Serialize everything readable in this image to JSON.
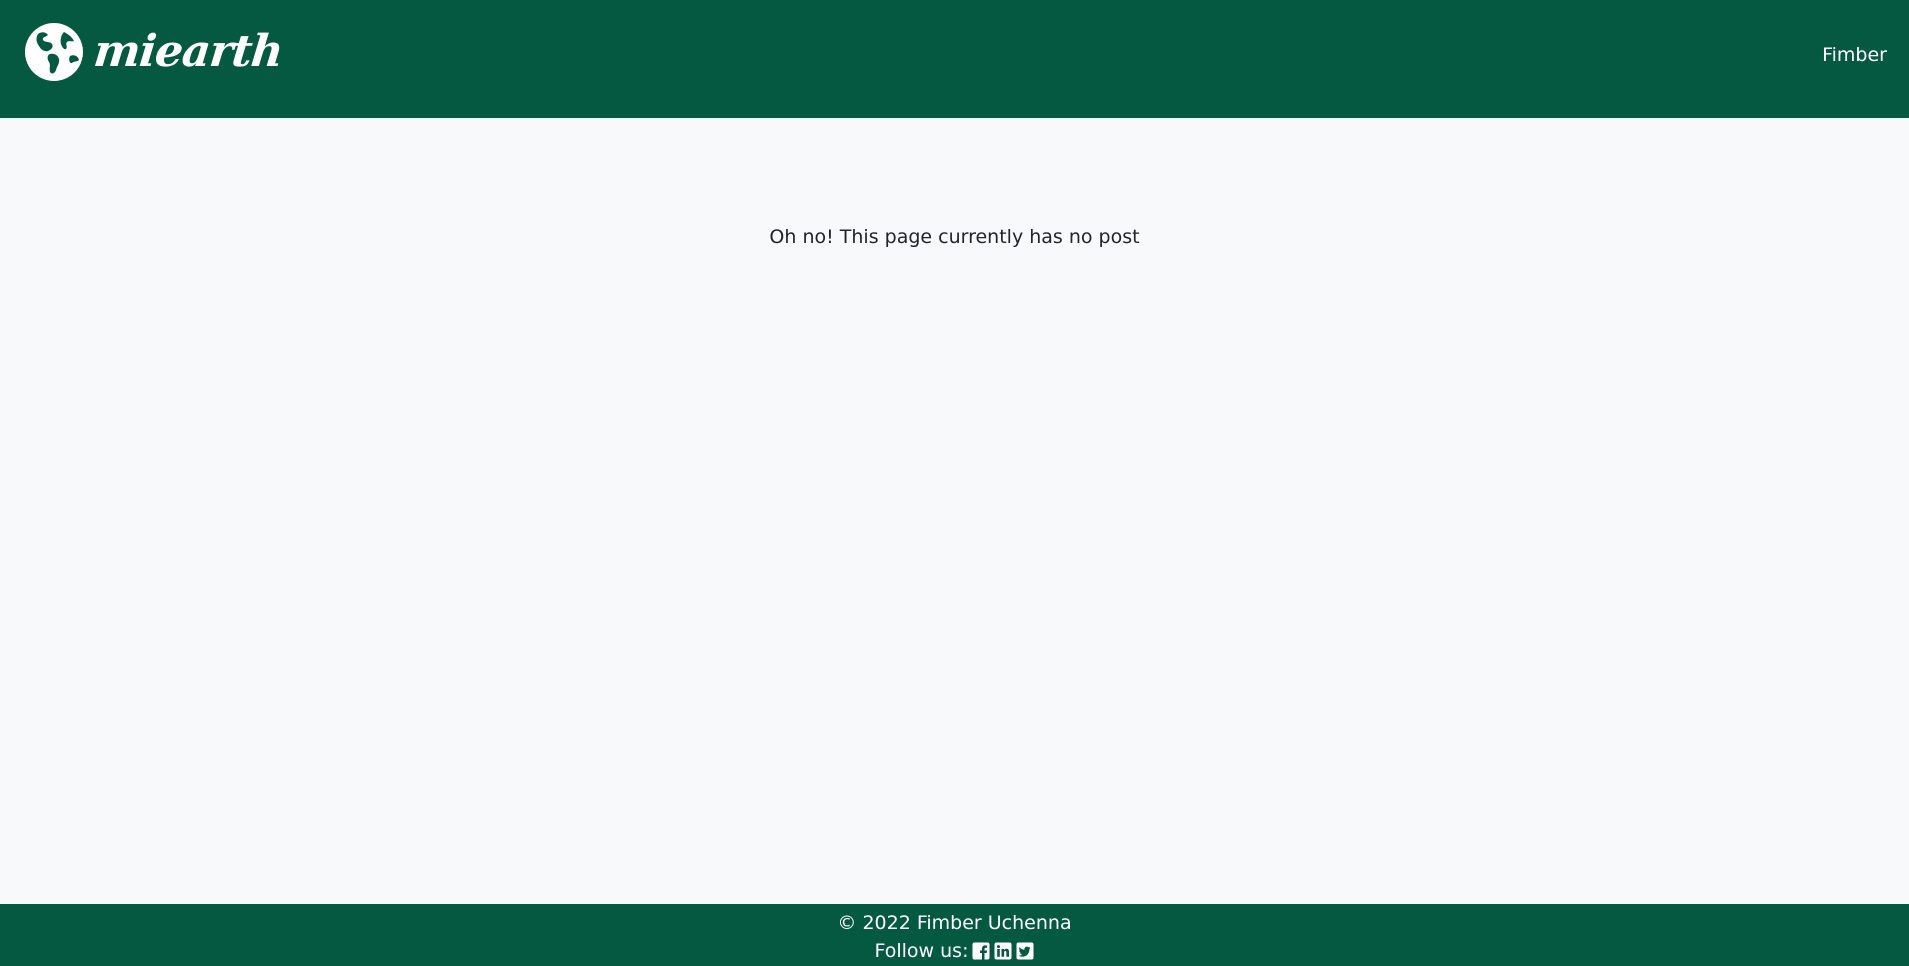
{
  "header": {
    "brand_name": "miearth",
    "user_link": "Fimber",
    "logo_icon": "globe-icon"
  },
  "main": {
    "empty_message": "Oh no! This page currently has no post"
  },
  "footer": {
    "copyright": "© 2022 Fimber Uchenna",
    "follow_label": "Follow us:",
    "social_icons": [
      "facebook-icon",
      "linkedin-icon",
      "twitter-icon"
    ]
  },
  "colors": {
    "brand": "#055941",
    "background": "#f8f9fa",
    "text": "#212529"
  }
}
